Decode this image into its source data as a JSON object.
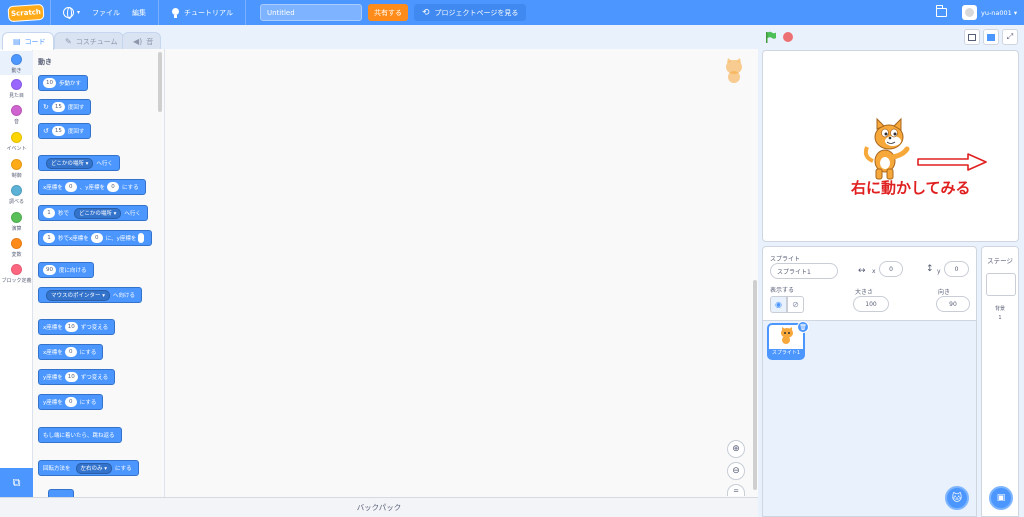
{
  "menubar": {
    "logo": "Scratch",
    "file": "ファイル",
    "edit": "編集",
    "tutorial": "チュートリアル",
    "title_value": "Untitled",
    "share": "共有する",
    "project_page": "プロジェクトページを見る",
    "username": "yu-na001"
  },
  "tabs": {
    "code": "コード",
    "costume": "コスチューム",
    "sound": "音"
  },
  "categories": [
    {
      "label": "動き",
      "color": "#4c97ff"
    },
    {
      "label": "見た目",
      "color": "#9966ff"
    },
    {
      "label": "音",
      "color": "#cf63cf"
    },
    {
      "label": "イベント",
      "color": "#ffd500"
    },
    {
      "label": "制御",
      "color": "#ffab19"
    },
    {
      "label": "調べる",
      "color": "#5cb1d6"
    },
    {
      "label": "演算",
      "color": "#59c059"
    },
    {
      "label": "変数",
      "color": "#ff8c1a"
    },
    {
      "label": "ブロック定義",
      "color": "#ff6680"
    }
  ],
  "palette": {
    "title": "動き",
    "move": {
      "value": "10",
      "text": "歩動かす"
    },
    "turn_right": {
      "value": "15",
      "text": "度回す"
    },
    "turn_left": {
      "value": "15",
      "text": "度回す"
    },
    "goto": {
      "drop": "どこかの場所",
      "text": "へ行く"
    },
    "goto_xy": {
      "t1": "x座標を",
      "x": "0",
      "t2": "、y座標を",
      "y": "0",
      "t3": "にする"
    },
    "glide": {
      "value": "1",
      "t1": "秒で",
      "drop": "どこかの場所",
      "t2": "へ行く"
    },
    "glide_xy": {
      "value": "1",
      "t1": "秒でx座標を",
      "x": "0",
      "t2": "に、y座標を"
    },
    "point_dir": {
      "value": "90",
      "text": "度に向ける"
    },
    "point_towards": {
      "drop": "マウスのポインター",
      "text": "へ向ける"
    },
    "change_x": {
      "t1": "x座標を",
      "value": "10",
      "t2": "ずつ変える"
    },
    "set_x": {
      "t1": "x座標を",
      "value": "0",
      "t2": "にする"
    },
    "change_y": {
      "t1": "y座標を",
      "value": "10",
      "t2": "ずつ変える"
    },
    "set_y": {
      "t1": "y座標を",
      "value": "0",
      "t2": "にする"
    },
    "bounce": "もし端に着いたら、跳ね返る",
    "rotation": {
      "t1": "回転方法を",
      "drop": "左右のみ",
      "t2": "にする"
    }
  },
  "backpack": "バックパック",
  "stage": {
    "annotation": "右に動かしてみる",
    "annotation_color": "#e02020"
  },
  "sprite_info": {
    "sprite_label": "スプライト",
    "sprite_name": "スプライト1",
    "x_label": "x",
    "x_value": "0",
    "y_label": "y",
    "y_value": "0",
    "show_label": "表示する",
    "size_label": "大きさ",
    "size_value": "100",
    "direction_label": "向き",
    "direction_value": "90"
  },
  "sprite_tile": {
    "label": "スプライト1"
  },
  "stage_pane": {
    "title": "ステージ",
    "backdrops_label": "背景",
    "backdrops_count": "1"
  },
  "colors": {
    "accent": "#4c97ff",
    "share": "#ff8c1a"
  }
}
